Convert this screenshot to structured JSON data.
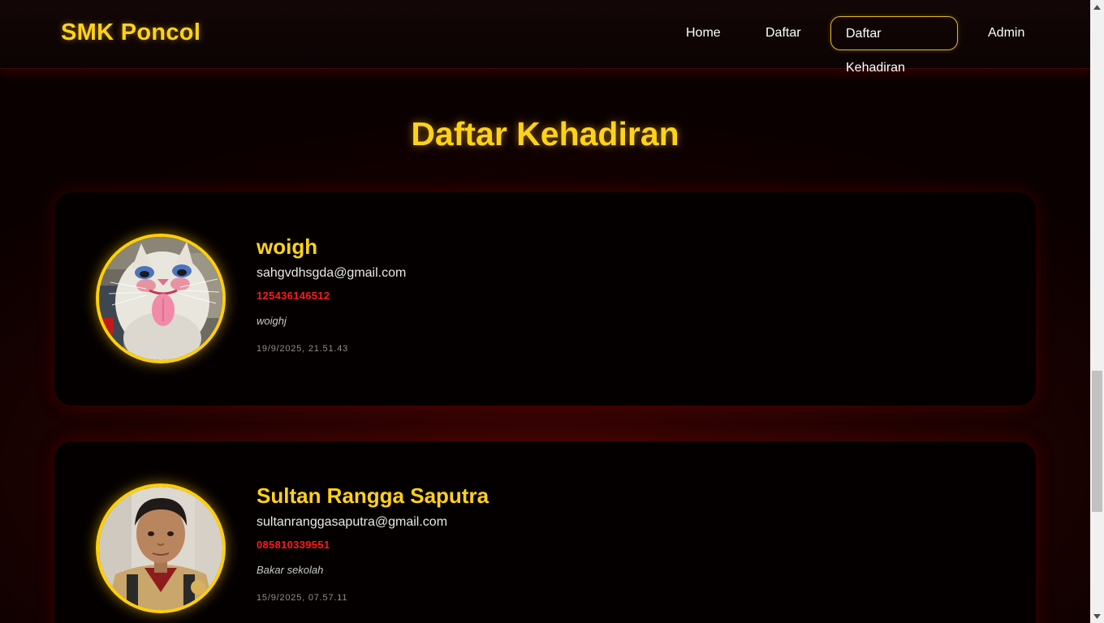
{
  "navbar": {
    "brand": "SMK Poncol",
    "links": [
      {
        "label": "Home",
        "active": false
      },
      {
        "label": "Daftar",
        "active": false
      },
      {
        "label": "Daftar Kehadiran",
        "active": true
      },
      {
        "label": "Admin",
        "active": false
      }
    ]
  },
  "main": {
    "title": "Daftar Kehadiran",
    "entries": [
      {
        "name": "woigh",
        "email": "sahgvdhsgda@gmail.com",
        "phone": "125436146512",
        "message": "woighj",
        "timestamp": "19/9/2025, 21.51.43",
        "avatar": "cat-photo"
      },
      {
        "name": "Sultan Rangga Saputra",
        "email": "sultanranggasaputra@gmail.com",
        "phone": "085810339551",
        "message": "Bakar sekolah",
        "timestamp": "15/9/2025, 07.57.11",
        "avatar": "person-photo"
      }
    ]
  },
  "colors": {
    "accent": "#ffd21a",
    "phone": "#ff1a1a",
    "background": "#0b0000",
    "card": "#050000"
  },
  "icons": {
    "scroll_up": "scroll-up-arrow-icon",
    "scroll_down": "scroll-down-arrow-icon"
  }
}
